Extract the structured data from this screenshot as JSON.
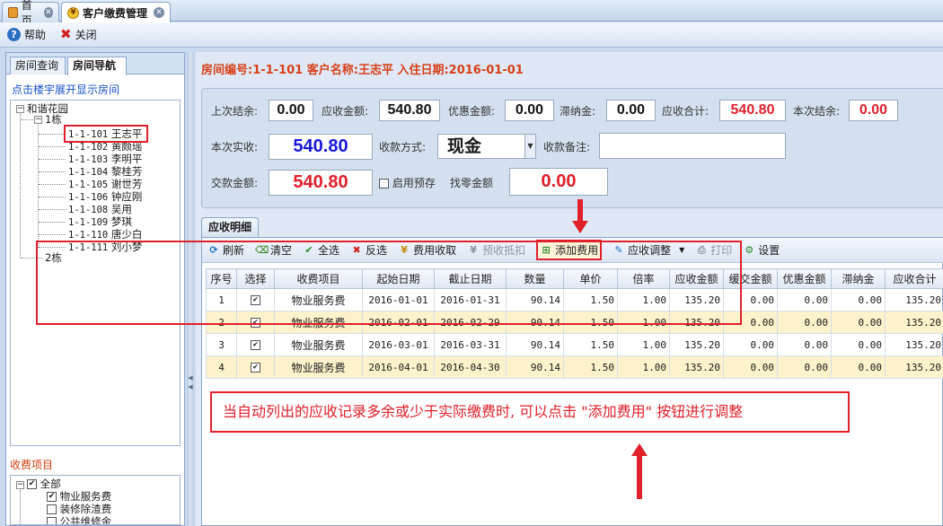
{
  "tabs": [
    {
      "label": "首页",
      "icon": "home-icon"
    },
    {
      "label": "客户缴费管理",
      "icon": "money-bag-icon"
    }
  ],
  "toolbar": {
    "help": "帮助",
    "close": "关闭"
  },
  "left": {
    "tab_room_query": "房间查询",
    "tab_room_nav": "房间导航",
    "hint": "点击楼宇展开显示房间",
    "tree": {
      "root": "和谐花园",
      "building1": "1栋",
      "building2": "2栋",
      "rooms": [
        {
          "code": "1-1-101",
          "name": "王志平"
        },
        {
          "code": "1-1-102",
          "name": "黄颇瑶"
        },
        {
          "code": "1-1-103",
          "name": "李明平"
        },
        {
          "code": "1-1-104",
          "name": "黎桂芳"
        },
        {
          "code": "1-1-105",
          "name": "谢世芳"
        },
        {
          "code": "1-1-106",
          "name": "钟应刚"
        },
        {
          "code": "1-1-108",
          "name": "吴用"
        },
        {
          "code": "1-1-109",
          "name": "梦琪"
        },
        {
          "code": "1-1-110",
          "name": "唐少白"
        },
        {
          "code": "1-1-111",
          "name": "刘小梦"
        }
      ]
    },
    "fee_label": "收费项目",
    "fee_items": {
      "all": "全部",
      "item1": "物业服务费",
      "item2": "装修除渣费",
      "item3": "公共维修金"
    }
  },
  "room_info": "房间编号:1-1-101 客户名称:王志平 入住日期:2016-01-01",
  "form": {
    "last_balance_label": "上次结余:",
    "last_balance": "0.00",
    "receivable_label": "应收金额:",
    "receivable": "540.80",
    "discount_label": "优惠金额:",
    "discount": "0.00",
    "late_fee_label": "滞纳金:",
    "late_fee": "0.00",
    "total_label": "应收合计:",
    "total": "540.80",
    "this_balance_label": "本次结余:",
    "this_balance": "0.00",
    "actual_label": "本次实收:",
    "actual": "540.80",
    "method_label": "收款方式:",
    "method": "现金",
    "remark_label": "收款备注:",
    "remark": "",
    "paid_label": "交款金额:",
    "paid": "540.80",
    "prepay_label": "启用预存",
    "change_label": "找零金额",
    "change": "0.00"
  },
  "detail": {
    "tab": "应收明细",
    "tools": [
      "刷新",
      "清空",
      "全选",
      "反选",
      "费用收取",
      "预收抵扣",
      "添加费用",
      "应收调整",
      "打印",
      "设置"
    ],
    "columns": [
      "序号",
      "选择",
      "收费项目",
      "起始日期",
      "截止日期",
      "数量",
      "单价",
      "倍率",
      "应收金额",
      "缓交金额",
      "优惠金额",
      "滞纳金",
      "应收合计"
    ],
    "rows": [
      [
        "1",
        "",
        "物业服务费",
        "2016-01-01",
        "2016-01-31",
        "90.14",
        "1.50",
        "1.00",
        "135.20",
        "0.00",
        "0.00",
        "0.00",
        "135.20"
      ],
      [
        "2",
        "",
        "物业服务费",
        "2016-02-01",
        "2016-02-29",
        "90.14",
        "1.50",
        "1.00",
        "135.20",
        "0.00",
        "0.00",
        "0.00",
        "135.20"
      ],
      [
        "3",
        "",
        "物业服务费",
        "2016-03-01",
        "2016-03-31",
        "90.14",
        "1.50",
        "1.00",
        "135.20",
        "0.00",
        "0.00",
        "0.00",
        "135.20"
      ],
      [
        "4",
        "",
        "物业服务费",
        "2016-04-01",
        "2016-04-30",
        "90.14",
        "1.50",
        "1.00",
        "135.20",
        "0.00",
        "0.00",
        "0.00",
        "135.20"
      ]
    ]
  },
  "note": "当自动列出的应收记录多余或少于实际缴费时, 可以点击 \"添加费用\" 按钮进行调整",
  "colors": {
    "accent_red": "#e0202a",
    "title_orange": "#d8401a",
    "amount_blue": "#1818d8",
    "row_alt": "#fcf3cc"
  }
}
